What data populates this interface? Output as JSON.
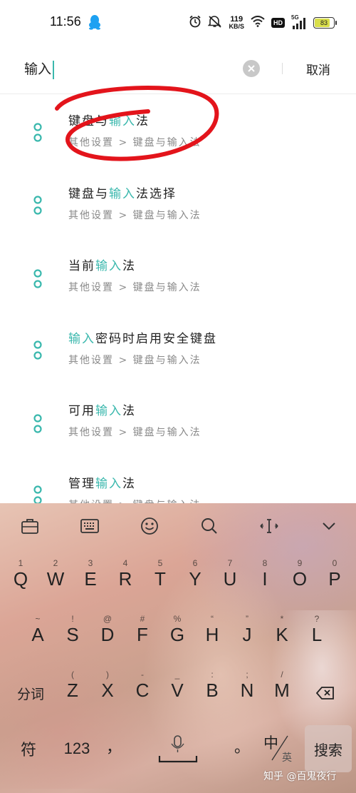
{
  "status_bar": {
    "time": "11:56",
    "net_speed_value": "119",
    "net_speed_unit": "KB/S",
    "hd_label": "HD",
    "signal_label": "5G",
    "battery_level": "83",
    "battery_fraction": 0.83,
    "icons": [
      "qq-icon",
      "alarm-icon",
      "mute-icon",
      "wifi-icon",
      "signal-icon",
      "battery-icon"
    ]
  },
  "search": {
    "value": "输入",
    "cancel_label": "取消"
  },
  "results": [
    {
      "before": "键盘与",
      "highlight": "输入",
      "after": "法",
      "path": "其他设置 > 键盘与输入法"
    },
    {
      "before": "键盘与",
      "highlight": "输入",
      "after": "法选择",
      "path": "其他设置 > 键盘与输入法"
    },
    {
      "before": "当前",
      "highlight": "输入",
      "after": "法",
      "path": "其他设置 > 键盘与输入法"
    },
    {
      "before": "",
      "highlight": "输入",
      "after": "密码时启用安全键盘",
      "path": "其他设置 > 键盘与输入法"
    },
    {
      "before": "可用",
      "highlight": "输入",
      "after": "法",
      "path": "其他设置 > 键盘与输入法"
    },
    {
      "before": "管理",
      "highlight": "输入",
      "after": "法",
      "path": "其他设置 > 键盘与输入法"
    }
  ],
  "keyboard": {
    "toolbar_icons": [
      "toolbox-icon",
      "keyboard-icon",
      "emoji-icon",
      "search-icon",
      "cursor-move-icon",
      "collapse-icon"
    ],
    "row1": [
      {
        "hint": "1",
        "key": "Q"
      },
      {
        "hint": "2",
        "key": "W"
      },
      {
        "hint": "3",
        "key": "E"
      },
      {
        "hint": "4",
        "key": "R"
      },
      {
        "hint": "5",
        "key": "T"
      },
      {
        "hint": "6",
        "key": "Y"
      },
      {
        "hint": "7",
        "key": "U"
      },
      {
        "hint": "8",
        "key": "I"
      },
      {
        "hint": "9",
        "key": "O"
      },
      {
        "hint": "0",
        "key": "P"
      }
    ],
    "row2": [
      {
        "hint": "~",
        "key": "A"
      },
      {
        "hint": "!",
        "key": "S"
      },
      {
        "hint": "@",
        "key": "D"
      },
      {
        "hint": "#",
        "key": "F"
      },
      {
        "hint": "%",
        "key": "G"
      },
      {
        "hint": "“",
        "key": "H"
      },
      {
        "hint": "”",
        "key": "J"
      },
      {
        "hint": "*",
        "key": "K"
      },
      {
        "hint": "?",
        "key": "L"
      }
    ],
    "row3": [
      {
        "hint": "(",
        "key": "Z"
      },
      {
        "hint": ")",
        "key": "X"
      },
      {
        "hint": "-",
        "key": "C"
      },
      {
        "hint": "_",
        "key": "V"
      },
      {
        "hint": ":",
        "key": "B"
      },
      {
        "hint": ";",
        "key": "N"
      },
      {
        "hint": "/",
        "key": "M"
      }
    ],
    "segment_key": "分词",
    "symbol_key": "符",
    "number_key": "123",
    "comma_key": "，",
    "period_key": "。",
    "lang_primary": "中",
    "lang_secondary": "英",
    "search_key": "搜索"
  },
  "watermark": "知乎 @百鬼夜行",
  "colors": {
    "accent": "#3ab8ad",
    "annotation_red": "#e3141b"
  }
}
